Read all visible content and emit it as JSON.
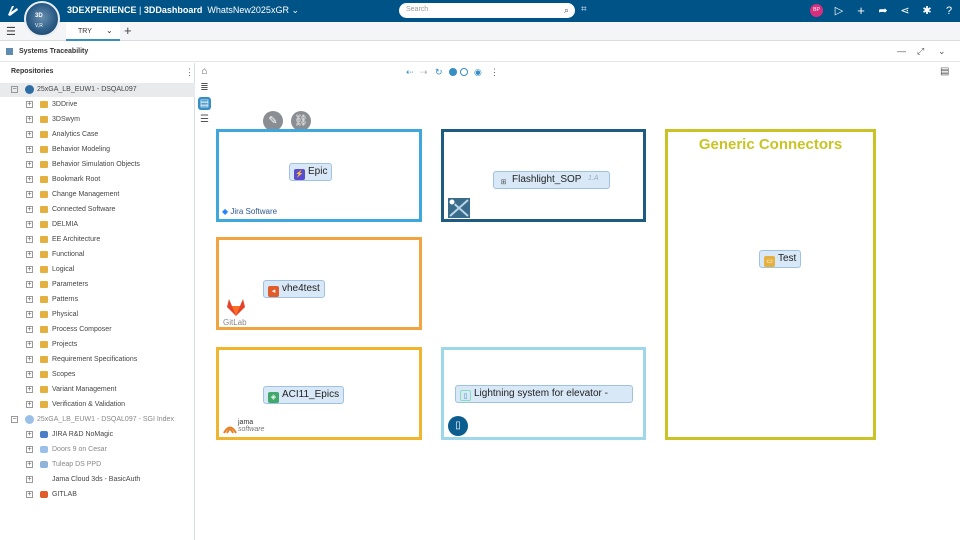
{
  "topbar": {
    "brand_word": "3DEXPERIENCE",
    "app_name": "3DDashboard",
    "dashboard_name": "WhatsNew2025xGR",
    "search_placeholder": "Search",
    "avatar_initials": "BP",
    "compass_3d": "3D",
    "compass_v": "V,R",
    "compass_r": "",
    "icons": [
      "tag-icon",
      "avatar",
      "share-icon",
      "add-icon",
      "forward-icon",
      "network-icon",
      "collaborate-icon",
      "help-icon"
    ]
  },
  "tabbar": {
    "tab_label": "TRY"
  },
  "widget": {
    "title": "Systems Traceability"
  },
  "repositories": {
    "heading": "Repositories",
    "root1": "25xGA_LB_EUW1 - DSQAL097",
    "folders": [
      "3DDrive",
      "3DSwym",
      "Analytics Case",
      "Behavior Modeling",
      "Behavior Simulation Objects",
      "Bookmark Root",
      "Change Management",
      "Connected Software",
      "DELMIA",
      "EE Architecture",
      "Functional",
      "Logical",
      "Parameters",
      "Patterns",
      "Physical",
      "Process Composer",
      "Projects",
      "Requirement Specifications",
      "Scopes",
      "Variant Management",
      "Verification & Validation"
    ],
    "root2": "25xGA_LB_EUW1 - DSQAL097 - SGI Index",
    "connectors": [
      {
        "label": "JIRA R&D NoMagic",
        "color": "#4a7fc8",
        "dim": false
      },
      {
        "label": "Doors 9 on Cesar",
        "color": "#9ac0e8",
        "dim": true
      },
      {
        "label": "Tuleap DS PPD",
        "color": "#8fb4da",
        "dim": true
      },
      {
        "label": "Jama Cloud 3ds - BasicAuth",
        "color": "#ffffff",
        "dim": false
      },
      {
        "label": "GITLAB",
        "color": "#e05a2a",
        "dim": false
      }
    ]
  },
  "canvas": {
    "boxes": [
      {
        "key": "jira",
        "color": "#3ea8dc",
        "chip": "Epic",
        "chip_icon_color": "#5a4bd1",
        "brand": "Jira Software"
      },
      {
        "key": "sop",
        "color": "#1f5b80",
        "chip": "Flashlight_SOP",
        "badge": "1.A"
      },
      {
        "key": "generic",
        "color": "#c9c326",
        "title": "Generic Connectors",
        "chip": "Test"
      },
      {
        "key": "gitlab",
        "color": "#f2a440",
        "chip": "vhe4test",
        "brand": "GitLab"
      },
      {
        "key": "jama",
        "color": "#f0b52f",
        "chip": "ACI11_Epics",
        "brand_line1": "jama",
        "brand_line2": "software"
      },
      {
        "key": "lightning",
        "color": "#9ed7ea",
        "chip": "Lightning system for elevator -"
      }
    ]
  }
}
